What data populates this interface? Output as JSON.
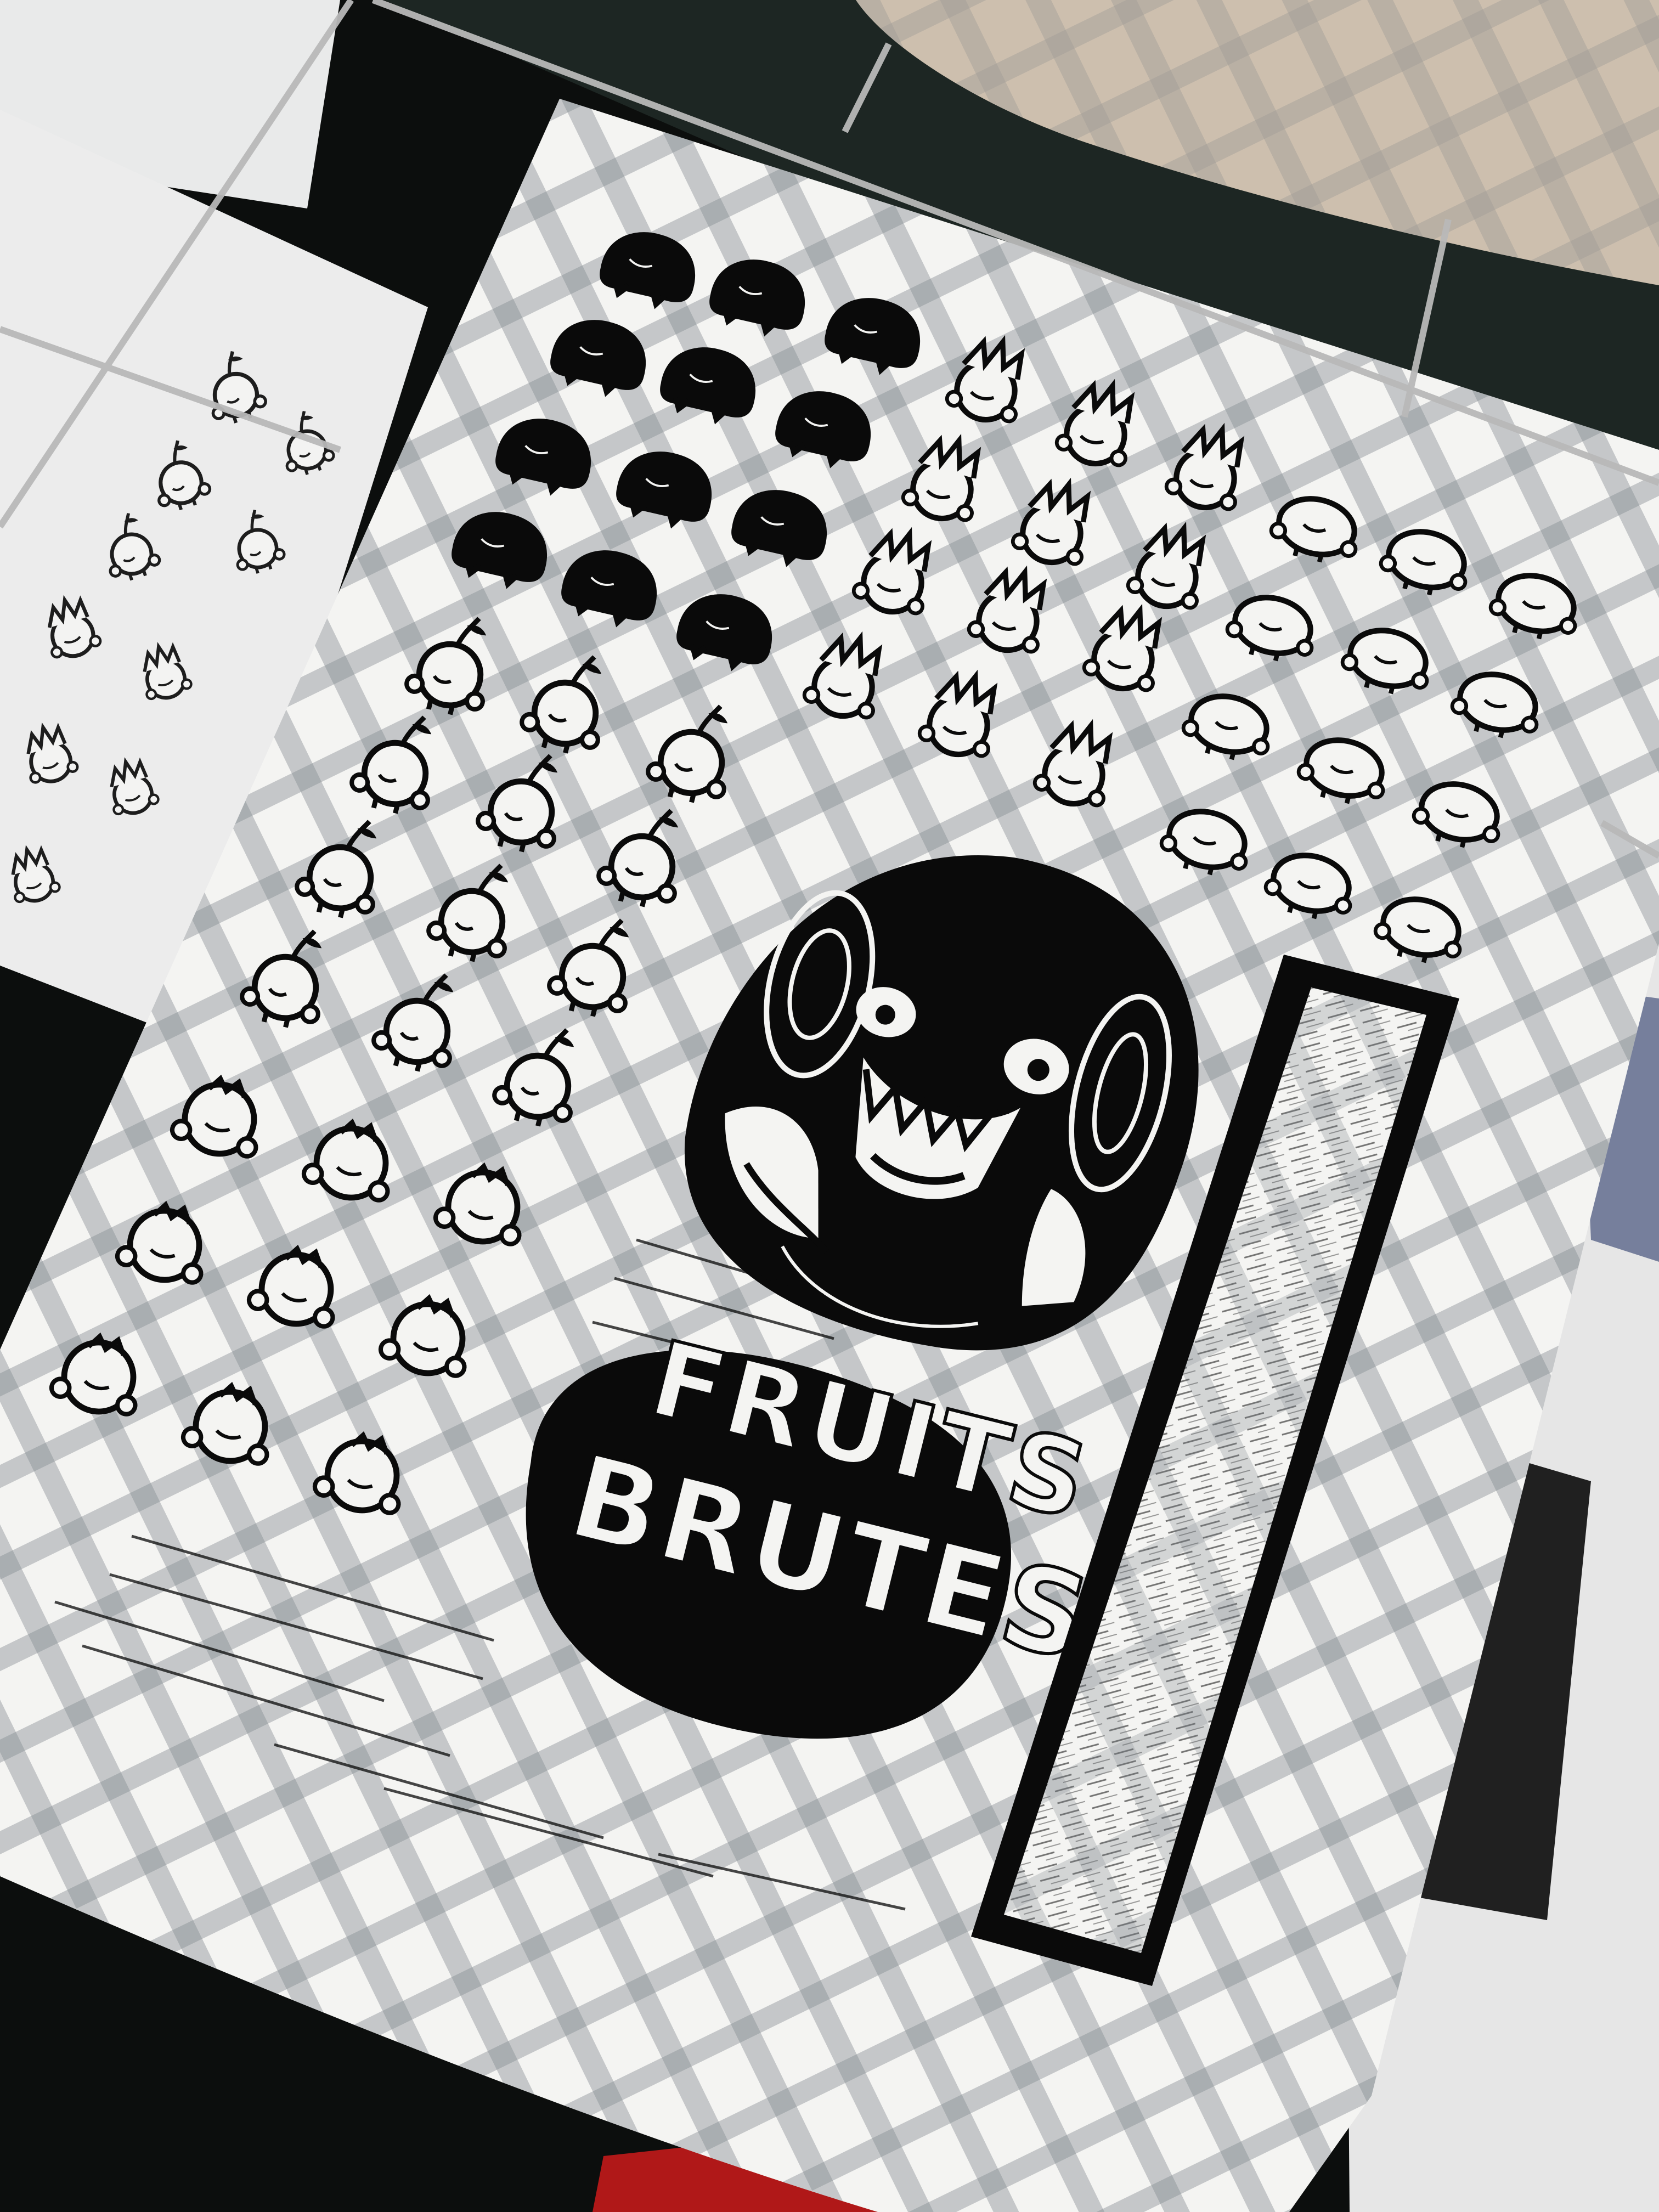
{
  "photo": {
    "print_title_line1": "FRUITS",
    "print_title_line2": "BRUTES",
    "colors": {
      "ink": "#0a0a0a",
      "paper": "#f4f4f2",
      "paper_shade": "#c9cbcc",
      "kraft_paper": "#cdbfae",
      "rack_metal": "#b9b9b9",
      "background_dark": "#0c0e0d",
      "red_accent": "#b01818"
    }
  }
}
